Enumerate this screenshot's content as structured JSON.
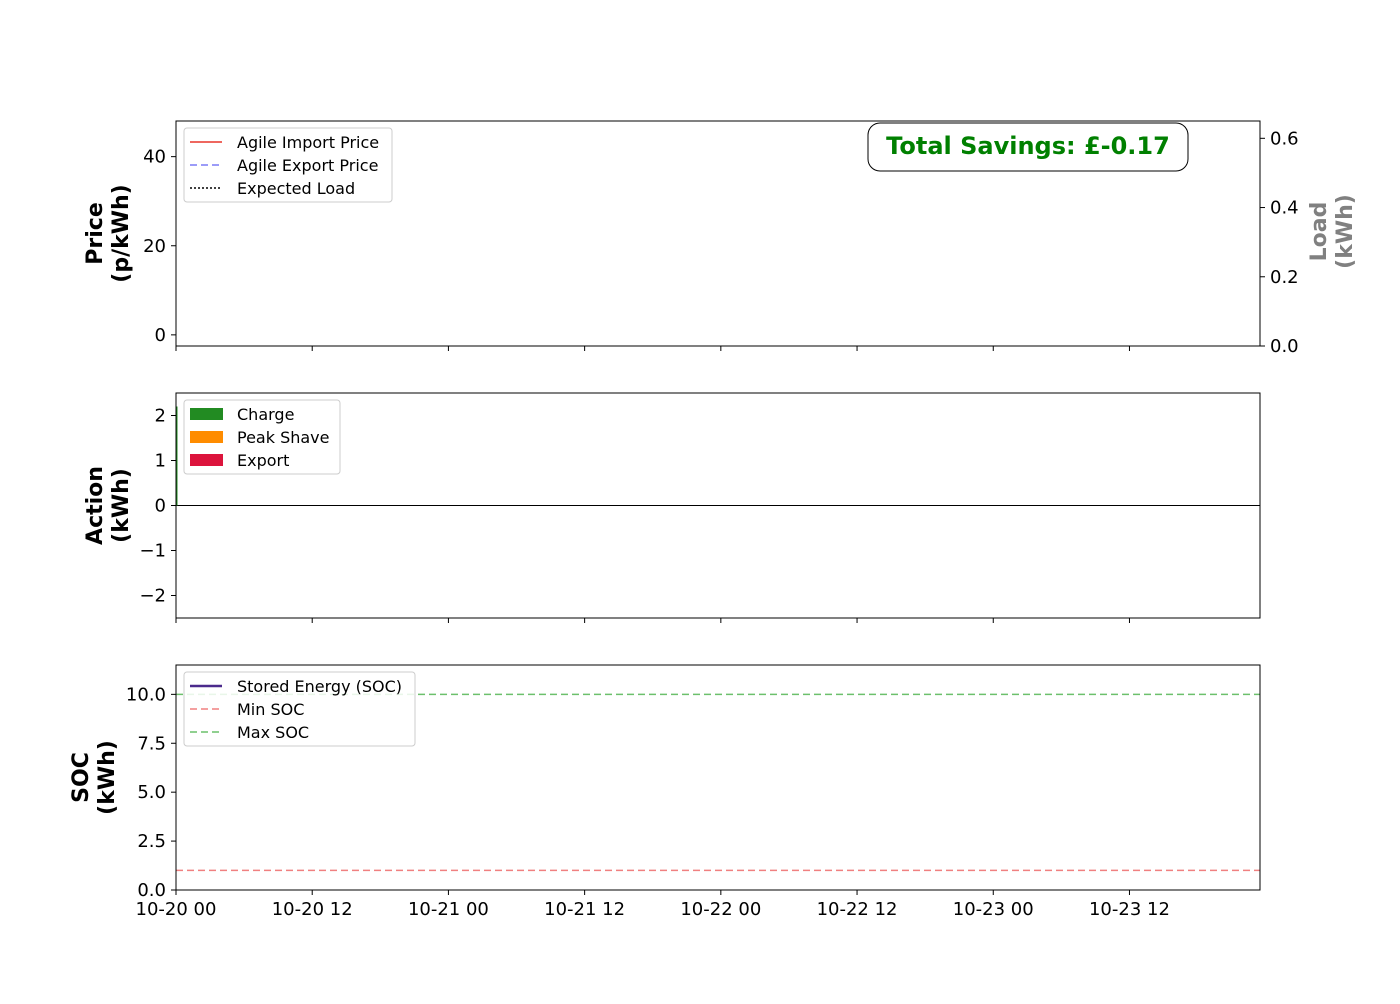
{
  "chart_data": [
    {
      "type": "line",
      "ylabel_lines": [
        "Price",
        "(p/kWh)"
      ],
      "ylabel2_lines": [
        "Load",
        "(kWh)"
      ],
      "ylim": [
        -2.5,
        48
      ],
      "yticks": [
        0,
        20,
        40
      ],
      "ylim2": [
        0,
        0.65
      ],
      "yticks2": [
        0.0,
        0.2,
        0.4,
        0.6
      ],
      "series": [
        {
          "name": "Agile Import Price",
          "color": "#e8352a",
          "style": "solid",
          "values": []
        },
        {
          "name": "Agile Export Price",
          "color": "#7b7bf5",
          "style": "dashed",
          "values": []
        },
        {
          "name": "Expected Load",
          "color": "#000000",
          "style": "dotted",
          "values": []
        }
      ],
      "annotation": {
        "text": "Total Savings: £-0.17",
        "color": "#008000"
      },
      "legend": "top-left"
    },
    {
      "type": "bar",
      "ylabel_lines": [
        "Action",
        "(kWh)"
      ],
      "ylim": [
        -2.5,
        2.5
      ],
      "yticks": [
        -2,
        -1,
        0,
        1,
        2
      ],
      "ytick_labels": [
        "−2",
        "−1",
        "0",
        "1",
        "2"
      ],
      "series": [
        {
          "name": "Charge",
          "color": "#228b22",
          "points": [
            {
              "x": "10-20 00",
              "y": 2.2
            }
          ]
        },
        {
          "name": "Peak Shave",
          "color": "#ff8c00",
          "points": []
        },
        {
          "name": "Export",
          "color": "#dc143c",
          "points": []
        }
      ],
      "legend": "top-left"
    },
    {
      "type": "line",
      "ylabel_lines": [
        "SOC",
        "(kWh)"
      ],
      "ylim": [
        0,
        11.5
      ],
      "yticks": [
        0.0,
        2.5,
        5.0,
        7.5,
        10.0
      ],
      "ytick_labels": [
        "0.0",
        "2.5",
        "5.0",
        "7.5",
        "10.0"
      ],
      "series": [
        {
          "name": "Stored Energy (SOC)",
          "color": "#4b2a8c",
          "style": "solid",
          "values": []
        },
        {
          "name": "Min SOC",
          "color": "#f08080",
          "style": "dashed",
          "value": 1.0
        },
        {
          "name": "Max SOC",
          "color": "#6cc06c",
          "style": "dashed",
          "value": 10.0
        }
      ],
      "legend": "top-left"
    }
  ],
  "x_axis": {
    "range_hours": [
      0,
      95.5
    ],
    "ticks": [
      {
        "hours": 0,
        "label": "10-20 00"
      },
      {
        "hours": 12,
        "label": "10-20 12"
      },
      {
        "hours": 24,
        "label": "10-21 00"
      },
      {
        "hours": 36,
        "label": "10-21 12"
      },
      {
        "hours": 48,
        "label": "10-22 00"
      },
      {
        "hours": 60,
        "label": "10-22 12"
      },
      {
        "hours": 72,
        "label": "10-23 00"
      },
      {
        "hours": 84,
        "label": "10-23 12"
      }
    ]
  }
}
